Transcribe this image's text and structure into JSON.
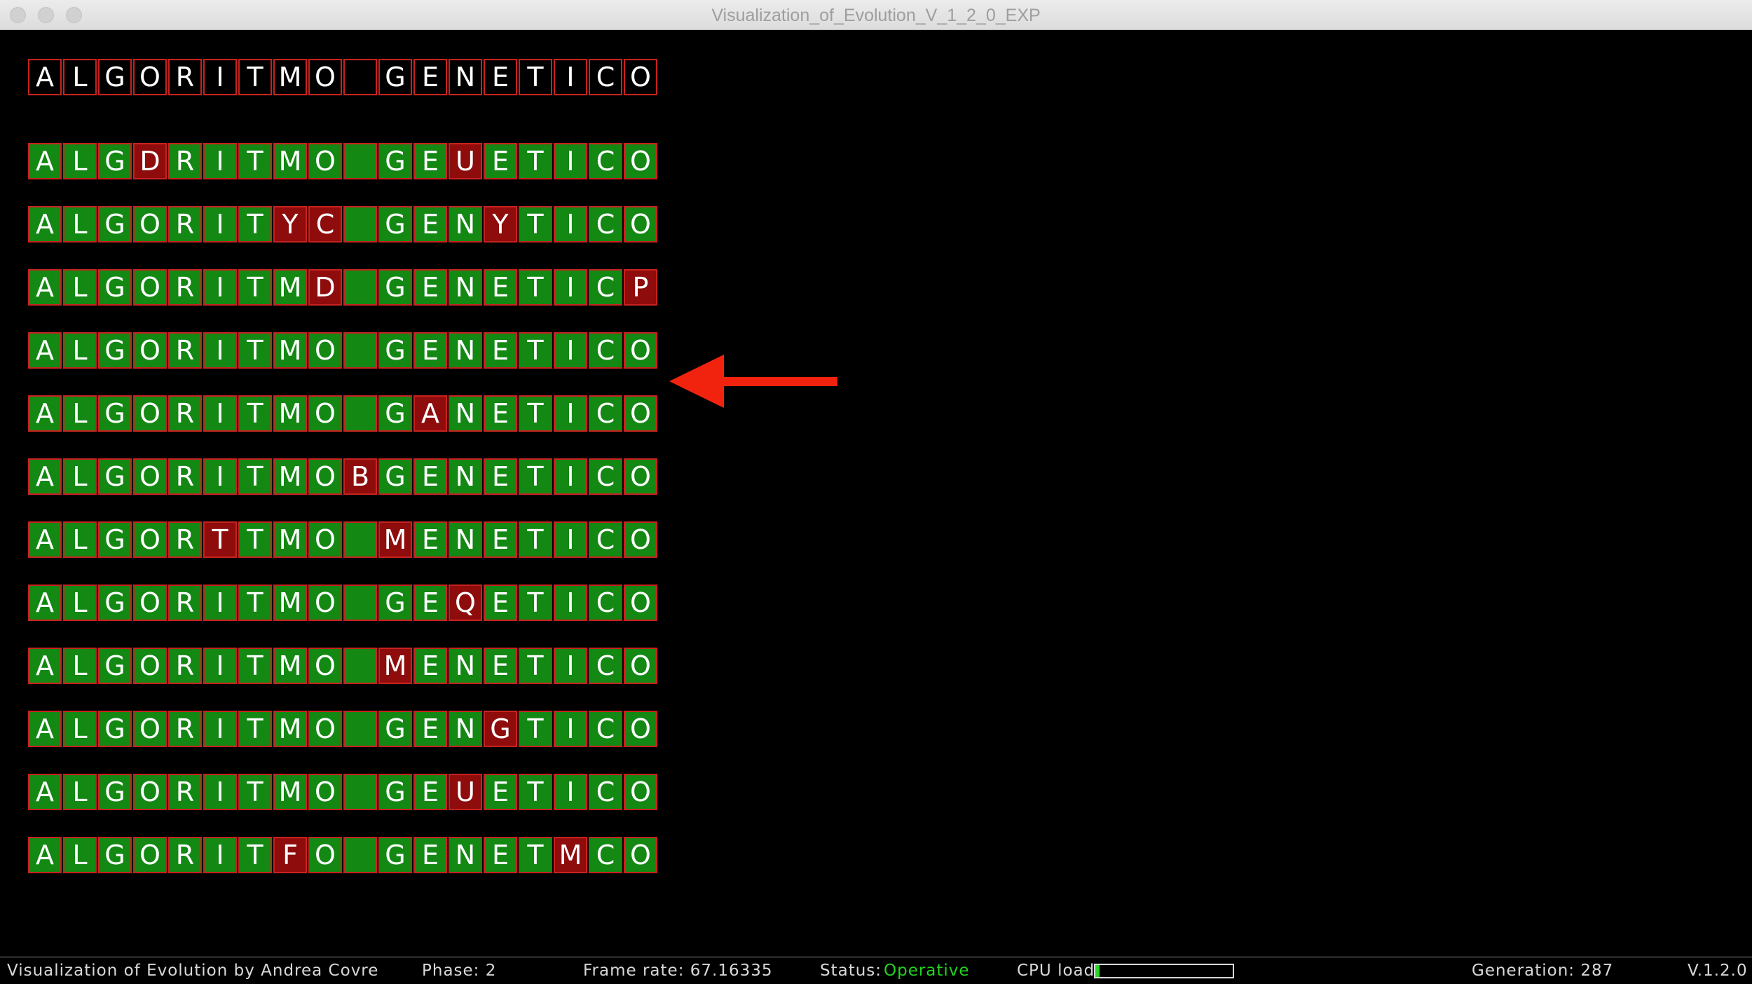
{
  "window": {
    "title": "Visualization_of_Evolution_V_1_2_0_EXP"
  },
  "target": "ALGORITMO GENETICO",
  "population": [
    "ALGDRITMO GEUETICO",
    "ALGORITYC GENYTICO",
    "ALGORITMD GENETICP",
    "ALGORITMO GENETICO",
    "ALGORITMO GANETICO",
    "ALGORITMOBGENETICO",
    "ALGORTTMO MENETICO",
    "ALGORITMO GEQETICO",
    "ALGORITMO MENETICO",
    "ALGORITMO GENGTICO",
    "ALGORITMO GEUETICO",
    "ALGORITFO GENETMCO"
  ],
  "highlighted_row_index": 3,
  "colors": {
    "match": "#138813",
    "mismatch": "#8e0c0c",
    "cell_border": "#c8221f",
    "arrow": "#f2230e",
    "status_ok": "#22d422"
  },
  "statusbar": {
    "credit": "Visualization of Evolution by Andrea Covre",
    "phase": "Phase: 2",
    "frame_rate": "Frame rate: 67.16335",
    "status_label": "Status:",
    "status_value": "Operative",
    "cpu_label": "CPU load",
    "cpu_load_fraction": 0.03,
    "generation": "Generation: 287",
    "version": "V.1.2.0"
  }
}
